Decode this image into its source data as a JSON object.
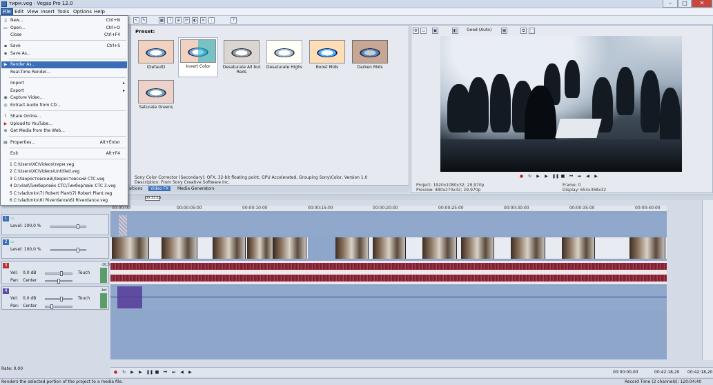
{
  "window": {
    "title": "тирм.veg - Vegas Pro 12.0",
    "controls": {
      "minimize": "–",
      "maximize": "□",
      "close": "✕"
    }
  },
  "menubar": [
    "File",
    "Edit",
    "View",
    "Insert",
    "Tools",
    "Options",
    "Help"
  ],
  "file_menu": {
    "items": [
      {
        "label": "New...",
        "shortcut": "Ctrl+N",
        "icon": "new-doc-icon"
      },
      {
        "label": "Open...",
        "shortcut": "Ctrl+O",
        "icon": "open-folder-icon"
      },
      {
        "label": "Close",
        "shortcut": "Ctrl+F4",
        "icon": ""
      },
      {
        "label": "Save",
        "shortcut": "Ctrl+S",
        "icon": "save-icon"
      },
      {
        "label": "Save As...",
        "shortcut": "",
        "icon": "save-as-icon"
      },
      {
        "label": "Render As...",
        "shortcut": "",
        "icon": "render-icon"
      },
      {
        "label": "Real-Time Render...",
        "shortcut": "",
        "icon": ""
      },
      {
        "label": "Import",
        "shortcut": "",
        "icon": "",
        "submenu": true
      },
      {
        "label": "Export",
        "shortcut": "",
        "icon": "",
        "submenu": true
      },
      {
        "label": "Capture Video...",
        "shortcut": "",
        "icon": "capture-icon"
      },
      {
        "label": "Extract Audio from CD...",
        "shortcut": "",
        "icon": "cd-icon"
      },
      {
        "label": "Share Online...",
        "shortcut": "",
        "icon": "share-icon"
      },
      {
        "label": "Upload to YouTube...",
        "shortcut": "",
        "icon": "youtube-icon"
      },
      {
        "label": "Get Media from the Web...",
        "shortcut": "",
        "icon": "web-icon"
      },
      {
        "label": "Properties...",
        "shortcut": "Alt+Enter",
        "icon": "properties-icon"
      },
      {
        "label": "Exit",
        "shortcut": "Alt+F4",
        "icon": ""
      },
      {
        "label": "1 C:\\Users\\XC\\Videos\\тирм.veg",
        "shortcut": "",
        "icon": ""
      },
      {
        "label": "2 C:\\Users\\XC\\Videos\\Untitled.veg",
        "shortcut": "",
        "icon": ""
      },
      {
        "label": "3 C:\\Хворостовский\\Хворостовский CTC.veg",
        "shortcut": "",
        "icon": ""
      },
      {
        "label": "4 D:\\vlad\\Тимберлейк CTC\\Тимберлейк CTC 3.veg",
        "shortcut": "",
        "icon": ""
      },
      {
        "label": "5 C:\\vlad\\mkv\\7) Robert Plant\\7) Robert Plant.veg",
        "shortcut": "",
        "icon": ""
      },
      {
        "label": "6 C:\\vlad\\mkv\\6) Riverdance\\6) Riverdance.veg",
        "shortcut": "",
        "icon": ""
      }
    ]
  },
  "fx": {
    "preset_label": "Preset:",
    "presets": [
      {
        "name": "(Default)",
        "style": ""
      },
      {
        "name": "Invert Color",
        "style": "invert"
      },
      {
        "name": "Desaturate All but Reds",
        "style": "gray"
      },
      {
        "name": "Desaturate Highs",
        "style": "high"
      },
      {
        "name": "Boost Mids",
        "style": "boost"
      },
      {
        "name": "Darken Mids",
        "style": "dark"
      },
      {
        "name": "Saturate Greens",
        "style": "green"
      }
    ],
    "description_line1": "Sony Color Corrector (Secondary): OFX, 32-bit floating point, GPU Accelerated, Grouping Sony\\Color, Version 1.0",
    "description_line2": "Description: From Sony Creative Software Inc.",
    "tabs": [
      "sitions",
      "Video FX",
      "Media Generators"
    ]
  },
  "preview": {
    "quality": "Good (Auto)",
    "project": "Project:   1920x1080x32; 29,970p",
    "preview": "Preview:  480x270x32; 29,970p",
    "frame": "Frame:     0",
    "display": "Display:   654x368x32"
  },
  "timeline": {
    "ruler": [
      "00:00:00",
      "00:00:05:00",
      "00:00:10:00",
      "00:00:15:00",
      "00:00:20:00",
      "00:00:25:00",
      "00:00:30:00",
      "00:00:35:00",
      "00:00:40:00"
    ],
    "marker": "00:33:15"
  },
  "tracks": [
    {
      "num": "1",
      "type": "video",
      "level": "Level: 100,0 %"
    },
    {
      "num": "2",
      "type": "video",
      "level": "Level: 100,0 %"
    },
    {
      "num": "3",
      "type": "audio",
      "vol": "Vol:",
      "vol_val": "0,0 dB",
      "pan": "Pan:",
      "pan_val": "Center",
      "mode": "Touch",
      "db": "-10,3"
    },
    {
      "num": "4",
      "type": "audio",
      "vol": "Vol:",
      "vol_val": "0,0 dB",
      "pan": "Pan:",
      "pan_val": "Center",
      "mode": "Touch",
      "db": "-Inf."
    }
  ],
  "bottom": {
    "rate": "Rate: 0,00",
    "time1": "00:00:00,00",
    "time2": "00:42:18,20",
    "time3": "00:42:18,20"
  },
  "status": {
    "left": "Renders the selected portion of the project to a media file.",
    "right": "Record Time (2 channels): 120:04:40"
  }
}
